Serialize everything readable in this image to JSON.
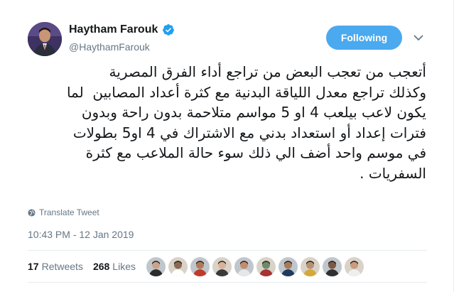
{
  "user": {
    "display_name": "Haytham Farouk",
    "handle": "@HaythamFarouk",
    "verified": true,
    "verified_icon": "verified-badge-icon"
  },
  "actions": {
    "follow_label": "Following",
    "menu_icon": "chevron-down-icon"
  },
  "tweet": {
    "text": "أتعجب من تعجب البعض من تراجع أداء الفرق المصرية\nوكذلك تراجع معدل اللياقة البدنية مع كثرة أعداد المصابين  لما\nيكون لاعب بيلعب 4 او 5 مواسم متلاحمة بدون راحة وبدون\nفترات إعداد أو استعداد بدني مع الاشتراك في 4 او5 بطولات\nفي موسم واحد أضف الي ذلك سوء حالة الملاعب مع كثرة\nالسفريات .",
    "translate_label": "Translate Tweet",
    "timestamp": "10:43 PM - 12 Jan 2019"
  },
  "stats": {
    "retweets_count": "17",
    "retweets_label": "Retweets",
    "likes_count": "268",
    "likes_label": "Likes"
  },
  "likers": [
    {
      "color": "#c9a48a",
      "shirt": "#2b2b2b"
    },
    {
      "color": "#8a6a55",
      "shirt": "#ffffff"
    },
    {
      "color": "#b07a5a",
      "shirt": "#c0392b"
    },
    {
      "color": "#d6b39a",
      "shirt": "#3a3a3a"
    },
    {
      "color": "#c48c6c",
      "shirt": "#e7e7e7"
    },
    {
      "color": "#6f8a6a",
      "shirt": "#a63232"
    },
    {
      "color": "#a67b5b",
      "shirt": "#1f3a5f"
    },
    {
      "color": "#b8926f",
      "shirt": "#d4a83a"
    },
    {
      "color": "#7b5a45",
      "shirt": "#2f2f2f"
    },
    {
      "color": "#c89c7c",
      "shirt": "#efefef"
    }
  ],
  "colors": {
    "accent": "#4aa9ef",
    "muted": "#657786",
    "text": "#14171a",
    "border": "#e6ecf0"
  }
}
